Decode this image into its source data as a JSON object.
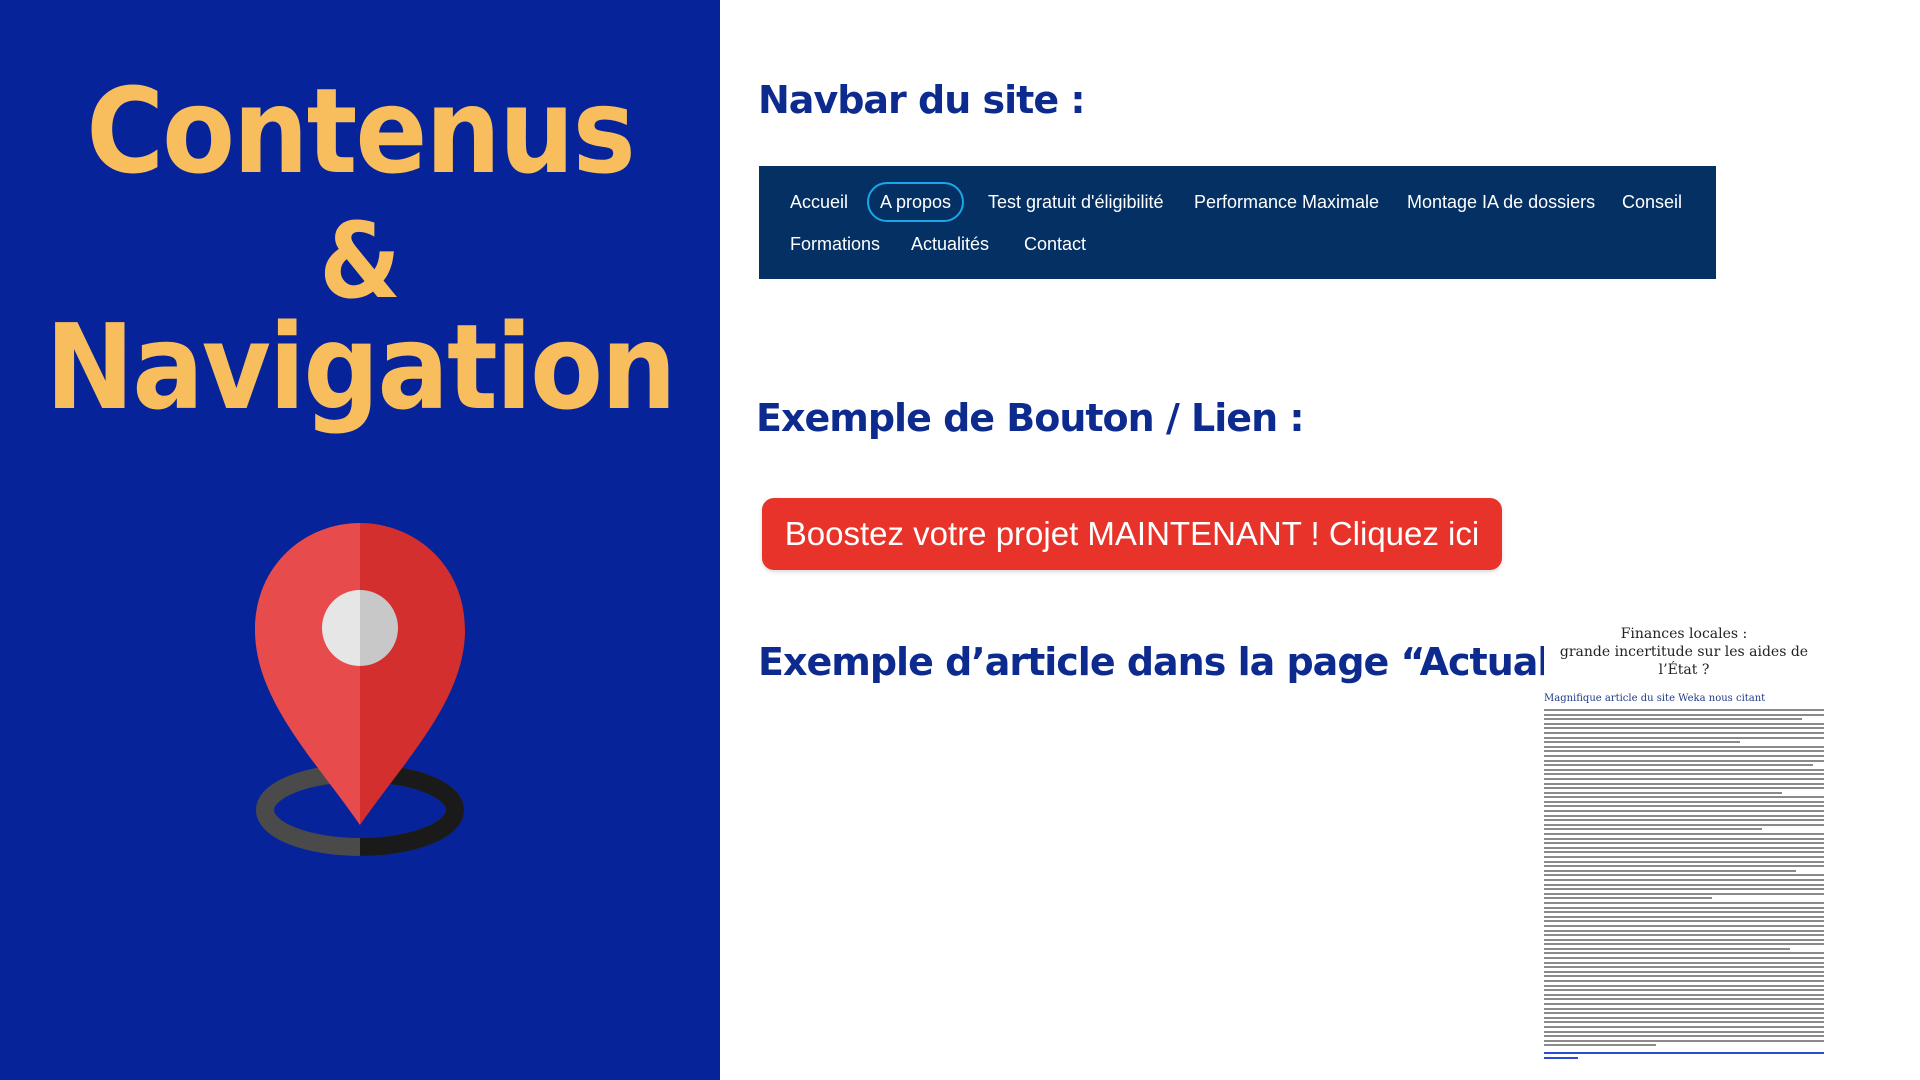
{
  "hero": {
    "line1": "Contenus",
    "line2": "&",
    "line3": "Navigation"
  },
  "icons": {
    "pin": "location-pin-icon"
  },
  "sections": {
    "navbar_heading": "Navbar du site :",
    "button_heading": "Exemple de Bouton / Lien :",
    "article_heading": "Exemple d’article dans la page “Actualités” :"
  },
  "navbar": {
    "row1": [
      "Accueil",
      "A propos",
      "Test gratuit d'éligibilité",
      "Performance Maximale",
      "Montage IA de dossiers",
      "Conseil"
    ],
    "row2": [
      "Formations",
      "Actualités",
      "Contact"
    ],
    "active": "A propos"
  },
  "cta": {
    "label": "Boostez votre projet MAINTENANT ! Cliquez ici"
  },
  "article": {
    "title_line1": "Finances locales :",
    "title_line2": "grande incertitude sur les aides de l’État ?",
    "subtitle": "Magnifique article du site Weka nous citant"
  },
  "colors": {
    "left_panel": "#06239a",
    "hero_text": "#f8bd5c",
    "heading": "#0d2a8f",
    "navbar_bg": "#043063",
    "active_border": "#19a7e8",
    "cta_bg": "#e8332a",
    "pin_red": "#e84b4b"
  }
}
